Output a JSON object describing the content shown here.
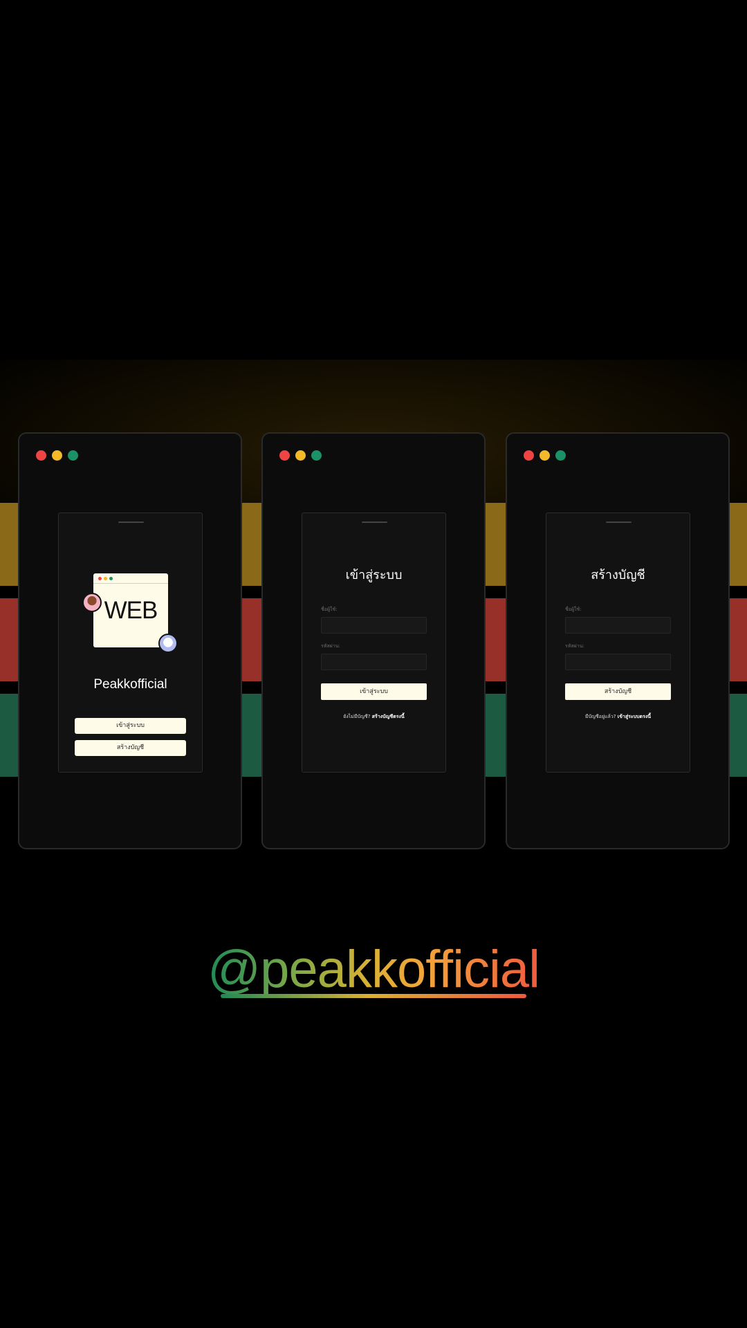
{
  "colors": {
    "background": "#000000",
    "window": "#0c0c0c",
    "card": "#121212",
    "button": "#fefce8",
    "traffic_red": "#ef4444",
    "traffic_yellow": "#f4b82b",
    "traffic_green": "#1a9166",
    "stripe_yellow": "#8a6a18",
    "stripe_red": "#973028",
    "stripe_green": "#1c5a42"
  },
  "welcome": {
    "illustration_word": "WEB",
    "brand": "Peakkofficial",
    "login_label": "เข้าสู่ระบบ",
    "signup_label": "สร้างบัญชี"
  },
  "login": {
    "title": "เข้าสู่ระบบ",
    "username_label": "ชื่อผู้ใช้:",
    "password_label": "รหัสผ่าน:",
    "submit_label": "เข้าสู่ระบบ",
    "footer_text": "ยังไม่มีบัญชี?",
    "footer_link": "สร้างบัญชีตรงนี้"
  },
  "signup": {
    "title": "สร้างบัญชี",
    "username_label": "ชื่อผู้ใช้:",
    "password_label": "รหัสผ่าน:",
    "submit_label": "สร้างบัญชี",
    "footer_text": "มีบัญชีอยู่แล้ว?",
    "footer_link": "เข้าสู่ระบบตรงนี้"
  },
  "handle": "@peakkofficial"
}
